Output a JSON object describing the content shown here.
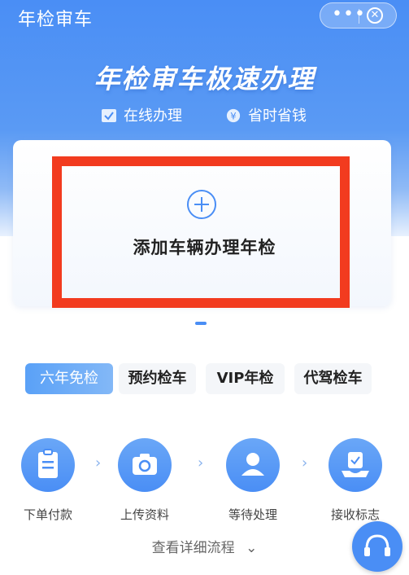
{
  "nav": {
    "title": "年检审车",
    "more_icon": "more-dots-icon",
    "close_icon": "close-circle-icon"
  },
  "hero": {
    "headline": "年检审车极速办理",
    "features": [
      {
        "label": "在线办理",
        "icon": "check-box-icon"
      },
      {
        "label": "省时省钱",
        "icon": "yen-coin-icon"
      }
    ]
  },
  "card": {
    "add_label": "添加车辆办理年检",
    "icon": "plus-circle-icon"
  },
  "tabs": [
    {
      "label": "六年免检",
      "active": true
    },
    {
      "label": "预约检车",
      "active": false
    },
    {
      "label": "VIP年检",
      "active": false
    },
    {
      "label": "代驾检车",
      "active": false
    }
  ],
  "steps": [
    {
      "label": "下单付款",
      "icon": "clipboard-icon"
    },
    {
      "label": "上传资料",
      "icon": "camera-icon"
    },
    {
      "label": "等待处理",
      "icon": "user-stamp-icon"
    },
    {
      "label": "接收标志",
      "icon": "receive-tray-icon"
    }
  ],
  "detail_link": "查看详细流程",
  "colors": {
    "accent": "#4a8ef5",
    "highlight_border": "#f23b1f"
  }
}
